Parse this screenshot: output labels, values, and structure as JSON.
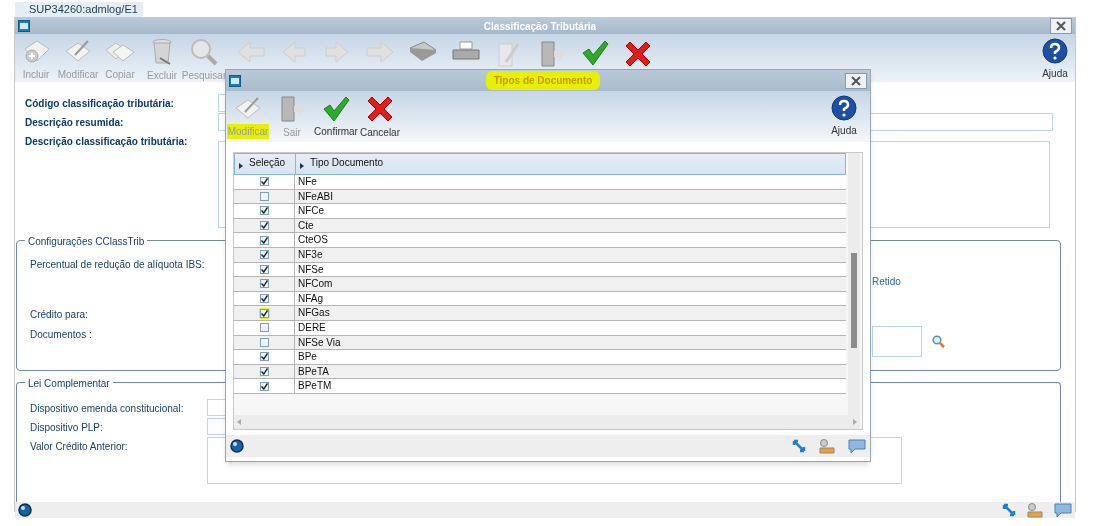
{
  "session_tab": {
    "label": "SUP34260:admlog/E1"
  },
  "window": {
    "title": "Classificação Tributária"
  },
  "toolbar": [
    {
      "label": "Incluir",
      "disabled": true
    },
    {
      "label": "Modificar",
      "disabled": true
    },
    {
      "label": "Copiar",
      "disabled": true
    },
    {
      "label": "Excluir",
      "disabled": true
    },
    {
      "label": "Pesquisar",
      "disabled": true
    }
  ],
  "help_button": {
    "label": "Ajuda"
  },
  "form": {
    "fields": [
      {
        "label": "Código classificação tributária:"
      },
      {
        "label": "Descrição resumida:"
      },
      {
        "label": "Descrição classificação tributária:"
      }
    ]
  },
  "group_cclasstrib": {
    "title": "Configurações CClassTrib",
    "labels": [
      "Percentual de redução de alíquota IBS:",
      "Crédito para:",
      "Documentos :"
    ],
    "retido_label": "Retido"
  },
  "group_lei": {
    "title": "Lei Complementar",
    "labels": [
      "Dispositivo emenda constitucional:",
      "Dispositivo PLP:",
      "Valor Crédito Anterior:"
    ]
  },
  "dialog": {
    "title": "Tipos de Documento",
    "title_highlighted": true,
    "toolbar": [
      {
        "label": "Modificar",
        "disabled": true,
        "highlighted": true
      },
      {
        "label": "Sair",
        "disabled": true,
        "highlighted": false
      },
      {
        "label": "Confirmar",
        "disabled": false,
        "highlighted": false
      },
      {
        "label": "Cancelar",
        "disabled": false,
        "highlighted": false
      }
    ],
    "help_button": {
      "label": "Ajuda"
    },
    "table": {
      "columns": [
        "Seleção",
        "Tipo Documento"
      ],
      "rows": [
        {
          "checked": true,
          "name": "NFe",
          "highlighted": false
        },
        {
          "checked": false,
          "name": "NFeABI",
          "highlighted": false
        },
        {
          "checked": true,
          "name": "NFCe",
          "highlighted": false
        },
        {
          "checked": true,
          "name": "Cte",
          "highlighted": false
        },
        {
          "checked": true,
          "name": "CteOS",
          "highlighted": false
        },
        {
          "checked": true,
          "name": "NF3e",
          "highlighted": false
        },
        {
          "checked": true,
          "name": "NFSe",
          "highlighted": false
        },
        {
          "checked": true,
          "name": "NFCom",
          "highlighted": false
        },
        {
          "checked": true,
          "name": "NFAg",
          "highlighted": false
        },
        {
          "checked": true,
          "name": "NFGas",
          "highlighted": true
        },
        {
          "checked": false,
          "name": "DERE",
          "highlighted": false
        },
        {
          "checked": false,
          "name": "NFSe Via",
          "highlighted": false
        },
        {
          "checked": true,
          "name": "BPe",
          "highlighted": false
        },
        {
          "checked": true,
          "name": "BPeTA",
          "highlighted": false
        },
        {
          "checked": true,
          "name": "BPeTM",
          "highlighted": false
        }
      ]
    }
  }
}
